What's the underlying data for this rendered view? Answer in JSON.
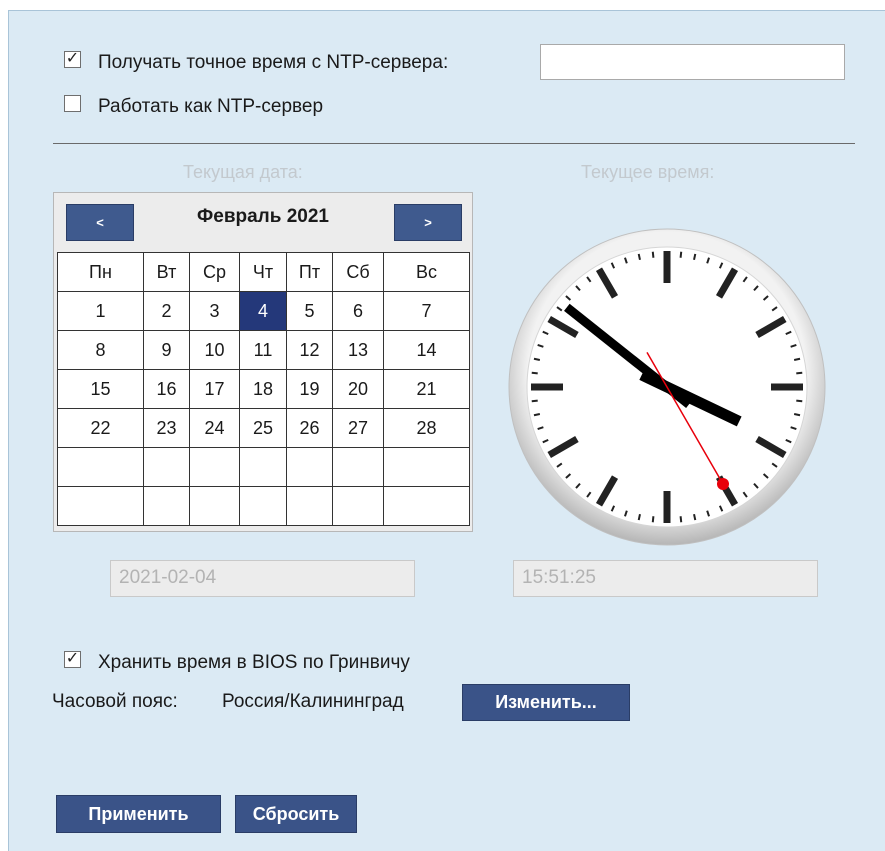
{
  "ntp": {
    "sync_checked": true,
    "sync_label": "Получать точное время с NTP-сервера:",
    "server_value": "",
    "server_mode_checked": false,
    "server_mode_label": "Работать как NTP-сервер"
  },
  "date_section": {
    "caption": "Текущая дата:",
    "prev_label": "<",
    "next_label": ">",
    "month_title": "Февраль 2021",
    "weekdays": [
      "Пн",
      "Вт",
      "Ср",
      "Чт",
      "Пт",
      "Сб",
      "Вс"
    ],
    "weeks": [
      [
        "1",
        "2",
        "3",
        "4",
        "5",
        "6",
        "7"
      ],
      [
        "8",
        "9",
        "10",
        "11",
        "12",
        "13",
        "14"
      ],
      [
        "15",
        "16",
        "17",
        "18",
        "19",
        "20",
        "21"
      ],
      [
        "22",
        "23",
        "24",
        "25",
        "26",
        "27",
        "28"
      ],
      [
        "",
        "",
        "",
        "",
        "",
        "",
        ""
      ],
      [
        "",
        "",
        "",
        "",
        "",
        "",
        ""
      ]
    ],
    "selected_day": "4",
    "date_value": "2021-02-04"
  },
  "time_section": {
    "caption": "Текущее время:",
    "time_value": "15:51:25",
    "clock": {
      "hours": 15,
      "minutes": 51,
      "seconds": 25
    }
  },
  "bios": {
    "utc_checked": true,
    "utc_label": "Хранить время в BIOS по Гринвичу"
  },
  "timezone": {
    "label": "Часовой пояс:",
    "value": "Россия/Калининград",
    "change_button": "Изменить..."
  },
  "actions": {
    "apply_label": "Применить",
    "reset_label": "Сбросить"
  },
  "colors": {
    "panel_bg": "#dbeaf4",
    "button_bg": "#3a5388",
    "selected_day_bg": "#24387a",
    "second_hand": "#e8000b"
  }
}
